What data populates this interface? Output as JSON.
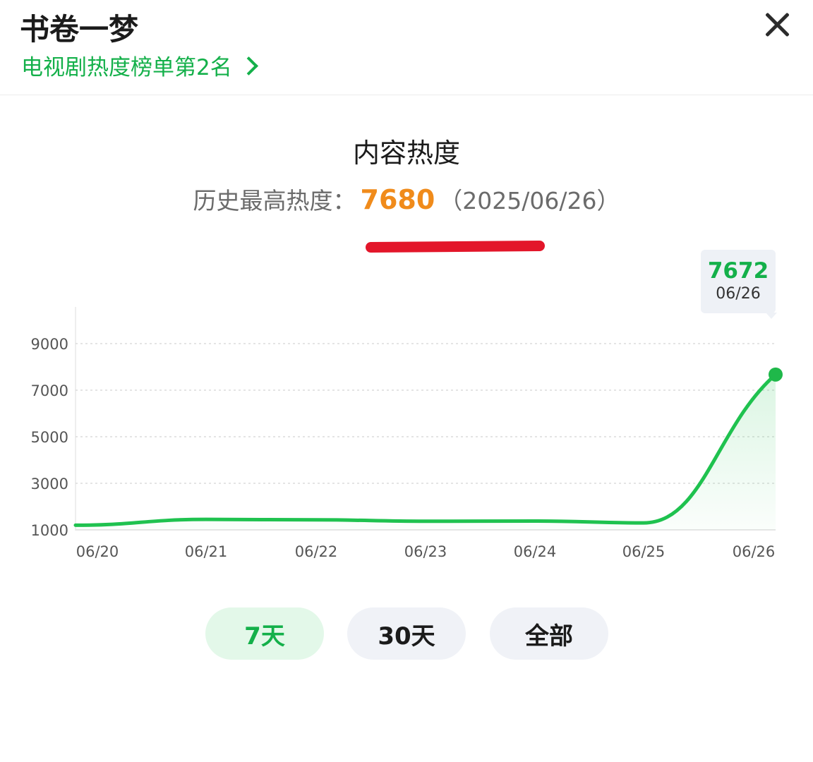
{
  "header": {
    "title": "书卷一梦",
    "subtitle": "电视剧热度榜单第2名"
  },
  "section": {
    "title": "内容热度",
    "peak_label": "历史最高热度：",
    "peak_value": "7680",
    "peak_date": "（2025/06/26）"
  },
  "tooltip": {
    "value": "7672",
    "date": "06/26"
  },
  "chart_data": {
    "type": "area",
    "x": [
      "06/20",
      "06/21",
      "06/22",
      "06/23",
      "06/24",
      "06/25",
      "06/26"
    ],
    "values": [
      1200,
      1450,
      1430,
      1370,
      1380,
      1300,
      7672
    ],
    "yticks": [
      "9000",
      "7000",
      "5000",
      "3000",
      "1000"
    ],
    "ylim": [
      1000,
      9000
    ],
    "grid": true,
    "line_color": "#1fc24f"
  },
  "ranges": [
    {
      "label": "7天",
      "active": true
    },
    {
      "label": "30天",
      "active": false
    },
    {
      "label": "全部",
      "active": false
    }
  ],
  "colors": {
    "accent": "#14b04a",
    "peak": "#f08b1b",
    "underline": "#e3162a"
  }
}
